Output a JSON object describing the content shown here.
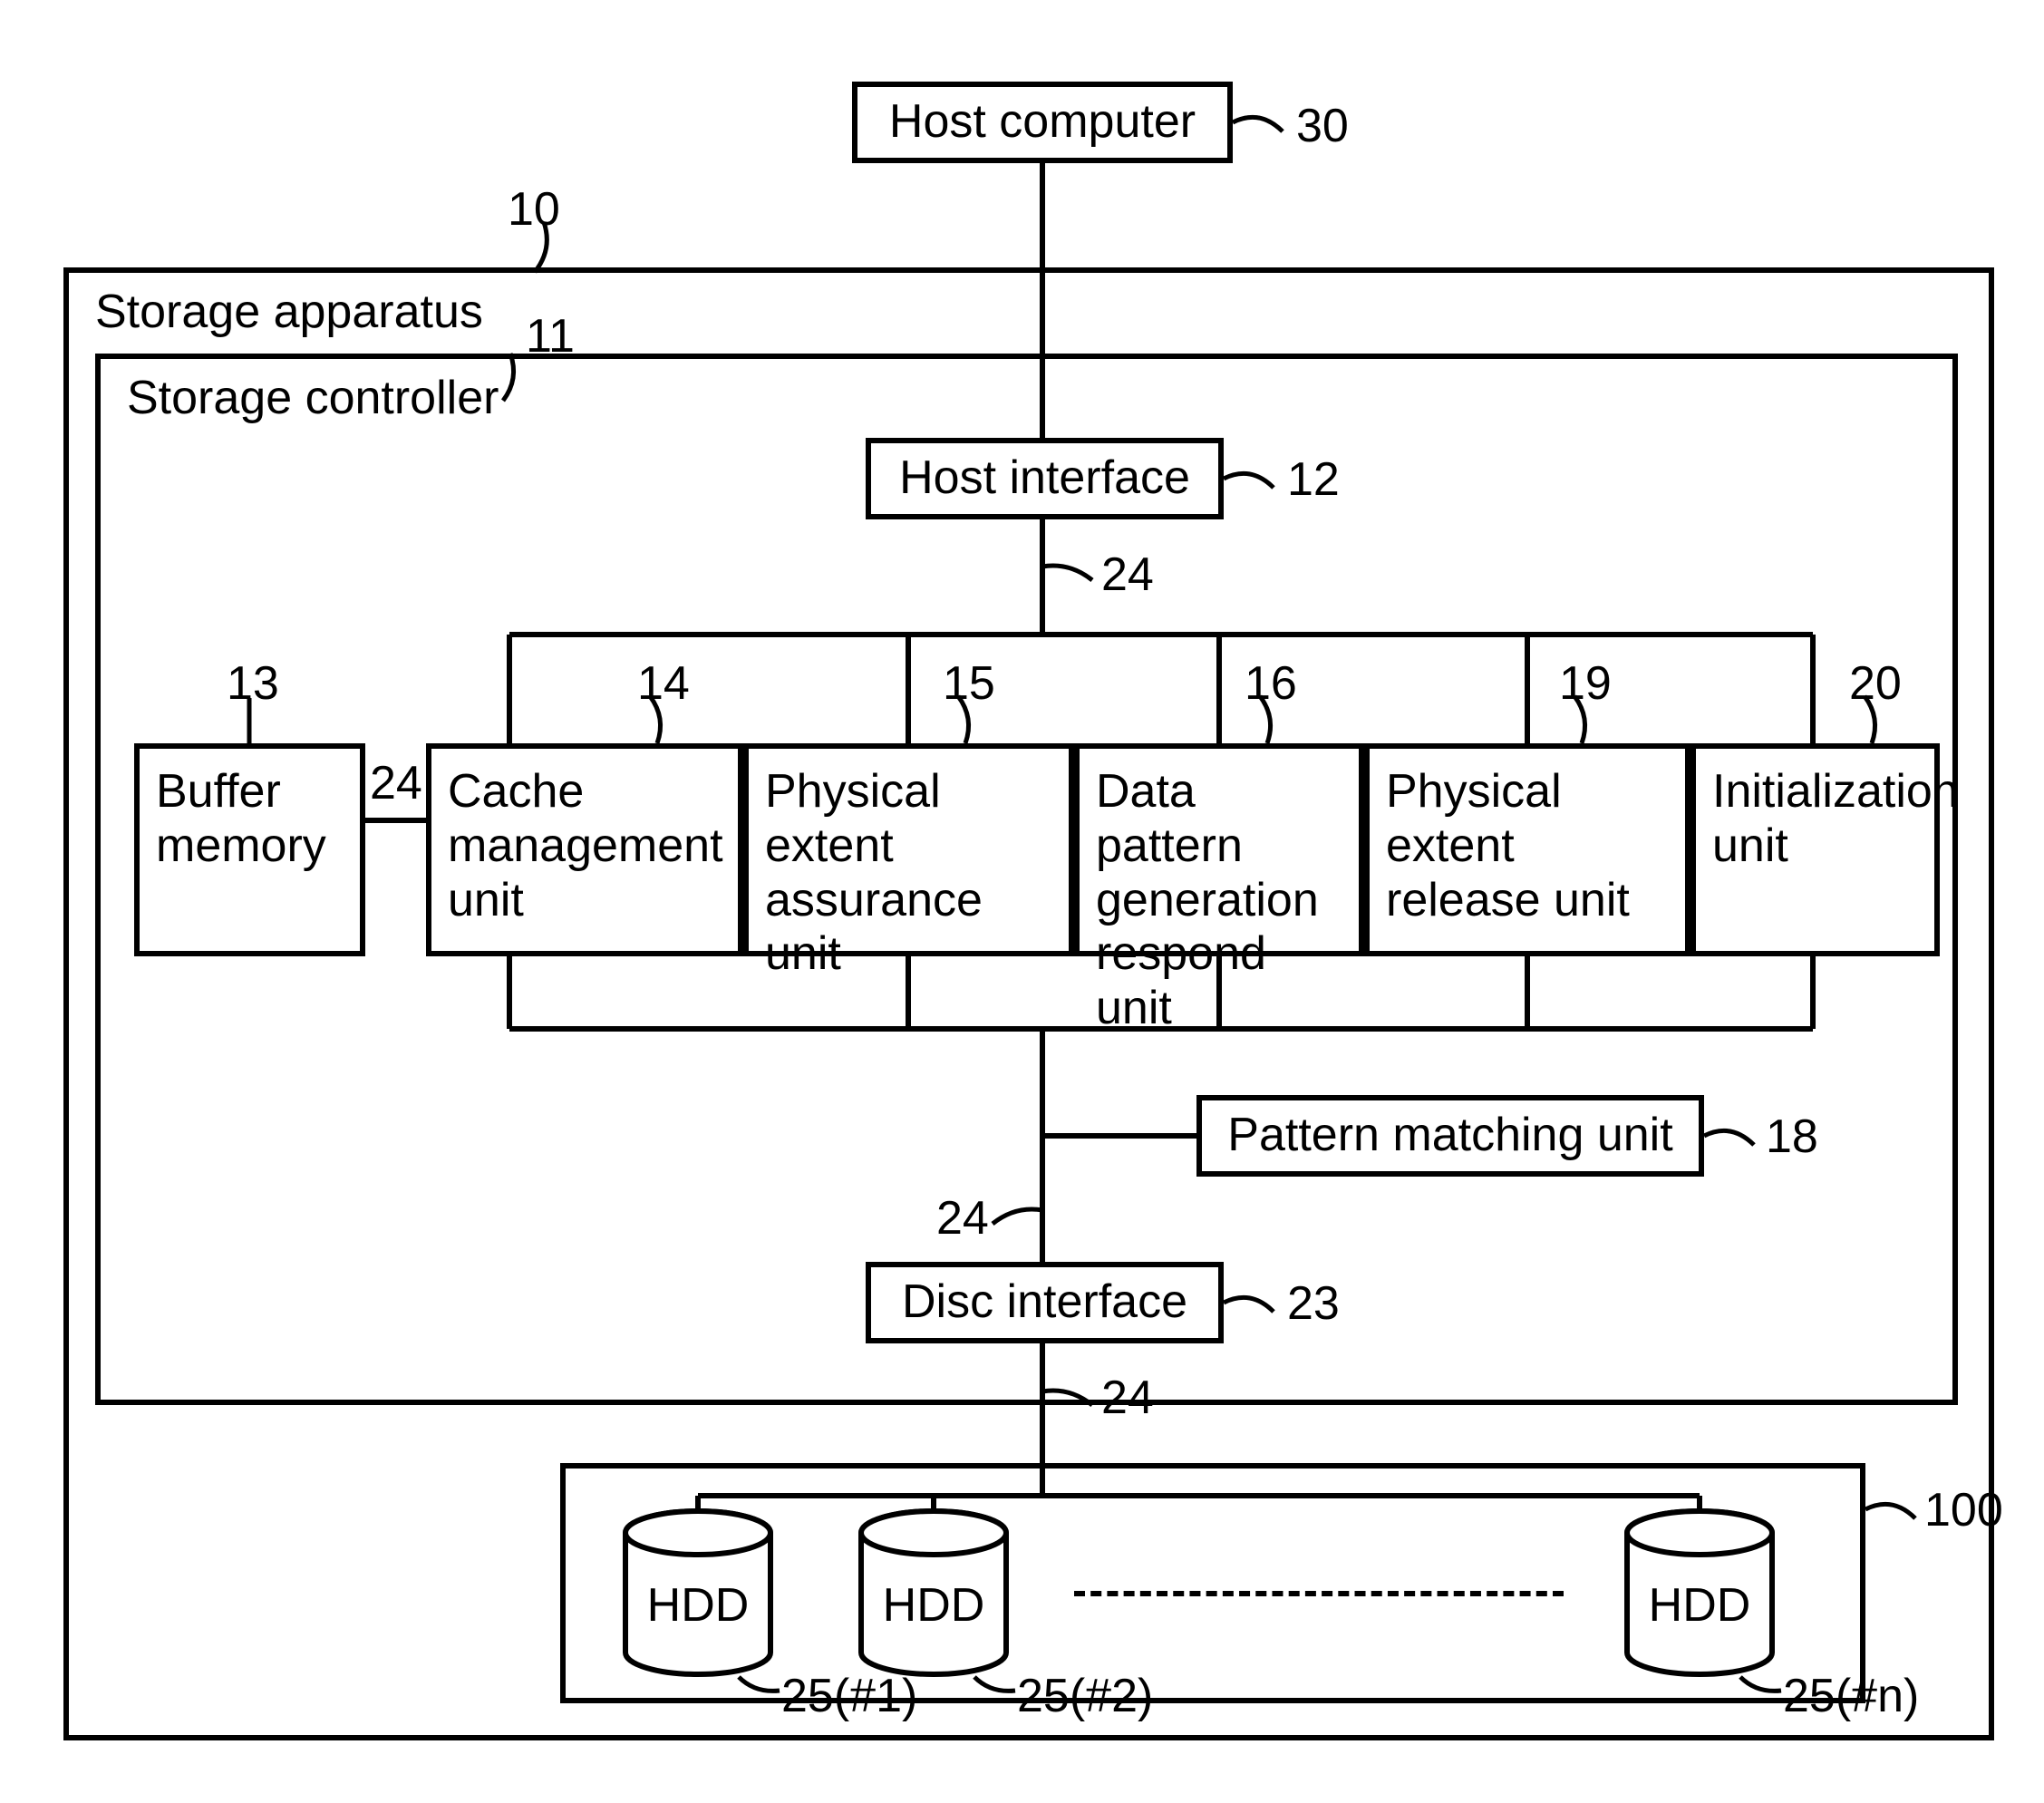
{
  "blocks": {
    "host_computer": "Host computer",
    "storage_apparatus": "Storage apparatus",
    "storage_controller": "Storage controller",
    "host_interface": "Host interface",
    "buffer_memory": "Buffer\nmemory",
    "cache_mgmt": "Cache\nmanagement\nunit",
    "phys_assurance": "Physical extent\nassurance unit",
    "data_pattern": "Data pattern\ngeneration\nrespond unit",
    "phys_release": "Physical extent\nrelease unit",
    "init_unit": "Initialization\nunit",
    "pattern_match": "Pattern matching unit",
    "disc_interface": "Disc interface",
    "hdd": "HDD"
  },
  "refs": {
    "host_computer": "30",
    "storage_apparatus": "10",
    "storage_controller": "11",
    "host_interface": "12",
    "buffer_memory": "13",
    "cache_mgmt": "14",
    "phys_assurance": "15",
    "data_pattern": "16",
    "phys_release": "19",
    "init_unit": "20",
    "pattern_match": "18",
    "disc_interface": "23",
    "bus": "24",
    "hdd1": "25(#1)",
    "hdd2": "25(#2)",
    "hddn": "25(#n)",
    "drive_group": "100"
  }
}
